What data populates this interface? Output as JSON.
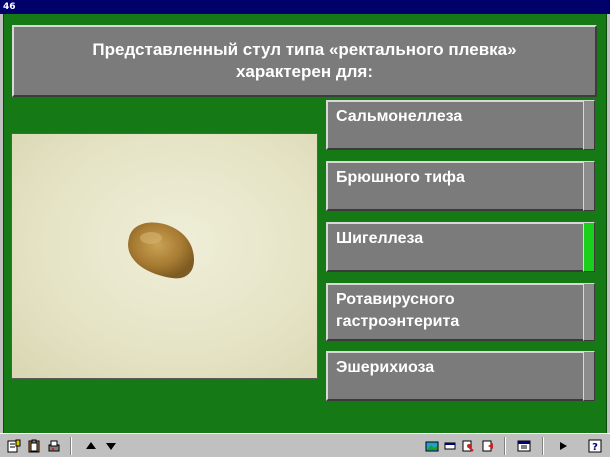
{
  "window": {
    "title": "46"
  },
  "question": {
    "line1": "Представленный стул типа «ректального плевка»",
    "line2": "характерен для:"
  },
  "answers": [
    {
      "label": "Сальмонеллеза",
      "state": "neutral"
    },
    {
      "label": "Брюшного тифа",
      "state": "neutral"
    },
    {
      "label": "Шигеллеза",
      "state": "correct"
    },
    {
      "label": "Ротавирусного гастроэнтерита",
      "state": "neutral"
    },
    {
      "label": "Эшерихиоза",
      "state": "neutral"
    }
  ],
  "colors": {
    "background": "#157a15",
    "panel": "#7b7b7b",
    "correct_indicator": "#1bd01b",
    "titlebar": "#00006a"
  },
  "toolbar": {
    "icons": [
      "notes-icon",
      "clipboard-icon",
      "print-icon",
      "arrow-up-icon",
      "arrow-down-icon",
      "picture-icon",
      "window-icon",
      "settings-icon",
      "exit-icon",
      "calendar-icon",
      "play-icon",
      "help-icon"
    ]
  }
}
